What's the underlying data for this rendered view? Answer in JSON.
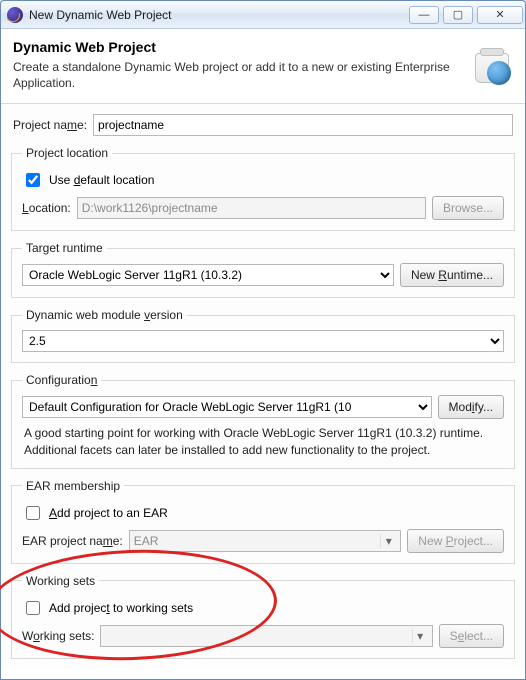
{
  "window": {
    "title": "New Dynamic Web Project"
  },
  "header": {
    "title": "Dynamic Web Project",
    "desc": "Create a standalone Dynamic Web project or add it to a new or existing Enterprise Application."
  },
  "project_name": {
    "label": "Project name:",
    "value": "projectname"
  },
  "location": {
    "legend": "Project location",
    "use_default_label": "Use default location",
    "use_default": true,
    "path_label": "Location:",
    "path_value": "D:\\work1126\\projectname",
    "browse": "Browse..."
  },
  "runtime": {
    "legend": "Target runtime",
    "value": "Oracle WebLogic Server 11gR1 (10.3.2)",
    "new_btn": "New Runtime..."
  },
  "webver": {
    "legend": "Dynamic web module version",
    "value": "2.5"
  },
  "config": {
    "legend": "Configuration",
    "value": "Default Configuration for Oracle WebLogic Server 11gR1 (10",
    "modify": "Modify...",
    "hint": "A good starting point for working with Oracle WebLogic Server 11gR1 (10.3.2) runtime. Additional facets can later be installed to add new functionality to the project."
  },
  "ear": {
    "legend": "EAR membership",
    "add_label": "Add project to an EAR",
    "add_checked": false,
    "name_label": "EAR project name:",
    "name_value": "EAR",
    "new_btn": "New Project..."
  },
  "working": {
    "legend": "Working sets",
    "add_label": "Add project to working sets",
    "add_checked": false,
    "sets_label": "Working sets:",
    "sets_value": "",
    "select_btn": "Select..."
  }
}
